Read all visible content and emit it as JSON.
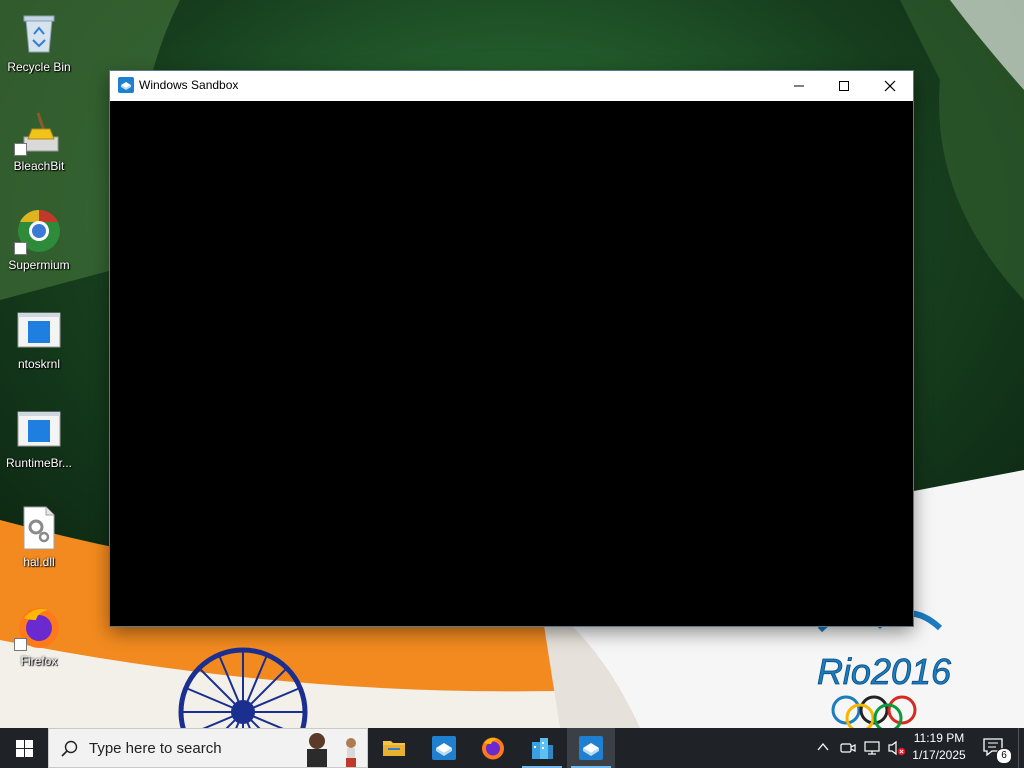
{
  "desktop": {
    "icons": [
      {
        "label": "Recycle Bin",
        "icon": "recycle-bin-icon"
      },
      {
        "label": "BleachBit",
        "icon": "bleachbit-icon"
      },
      {
        "label": "Supermium",
        "icon": "supermium-icon"
      },
      {
        "label": "ntoskrnl",
        "icon": "executable-icon"
      },
      {
        "label": "RuntimeBr...",
        "icon": "executable-icon"
      },
      {
        "label": "hal.dll",
        "icon": "dll-file-icon"
      },
      {
        "label": "Firefox",
        "icon": "firefox-icon"
      }
    ],
    "wallpaper": {
      "logo_text": "Rio2016",
      "colors": {
        "saffron": "#f28a1f",
        "green": "#1c5a24",
        "white": "#f4f4f4",
        "chakra": "#1a2f8f"
      }
    }
  },
  "window": {
    "title": "Windows Sandbox",
    "content_color": "#000000",
    "buttons": [
      "minimize",
      "maximize",
      "close"
    ]
  },
  "taskbar": {
    "search_placeholder": "Type here to search",
    "apps": [
      {
        "name": "File Explorer",
        "icon": "folder-icon",
        "running": false
      },
      {
        "name": "Windows Sandbox",
        "icon": "sandbox-icon",
        "running": false
      },
      {
        "name": "Firefox",
        "icon": "firefox-icon",
        "running": false
      },
      {
        "name": "Buildings app",
        "icon": "buildings-icon",
        "running": true
      },
      {
        "name": "Windows Sandbox",
        "icon": "sandbox-icon",
        "running": true,
        "active": true
      }
    ],
    "tray": {
      "icons": [
        "chevron-up-icon",
        "meet-now-icon",
        "network-icon",
        "volume-muted-icon"
      ],
      "time": "11:19 PM",
      "date": "1/17/2025",
      "notification_count": "6"
    },
    "accent_color": "#76b9ed"
  }
}
